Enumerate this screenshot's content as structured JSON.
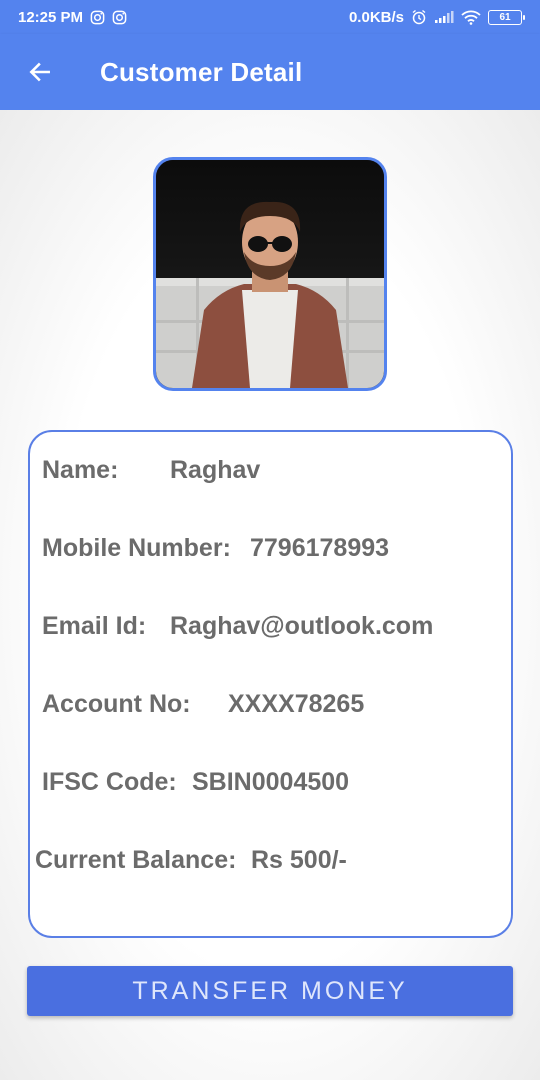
{
  "status_bar": {
    "time": "12:25 PM",
    "net_speed": "0.0KB/s",
    "battery": "61",
    "icons": [
      "instagram-icon",
      "instagram-icon",
      "alarm-icon",
      "signal-icon",
      "wifi-icon",
      "battery-icon"
    ]
  },
  "app_bar": {
    "title": "Customer Detail",
    "back_icon": "arrow-left-icon"
  },
  "customer": {
    "name_label": "Name:",
    "name_value": "Raghav",
    "mobile_label": "Mobile Number:",
    "mobile_value": "7796178993",
    "email_label": "Email Id:",
    "email_value": "Raghav@outlook.com",
    "account_label": "Account No:",
    "account_value": "XXXX78265",
    "ifsc_label": "IFSC Code:",
    "ifsc_value": "SBIN0004500",
    "balance_label": "Current Balance:",
    "balance_value": "Rs 500/-"
  },
  "actions": {
    "transfer_label": "TRANSFER MONEY"
  },
  "colors": {
    "primary": "#5483ee",
    "button": "#4a6fe0",
    "text": "#6b6b6b"
  }
}
